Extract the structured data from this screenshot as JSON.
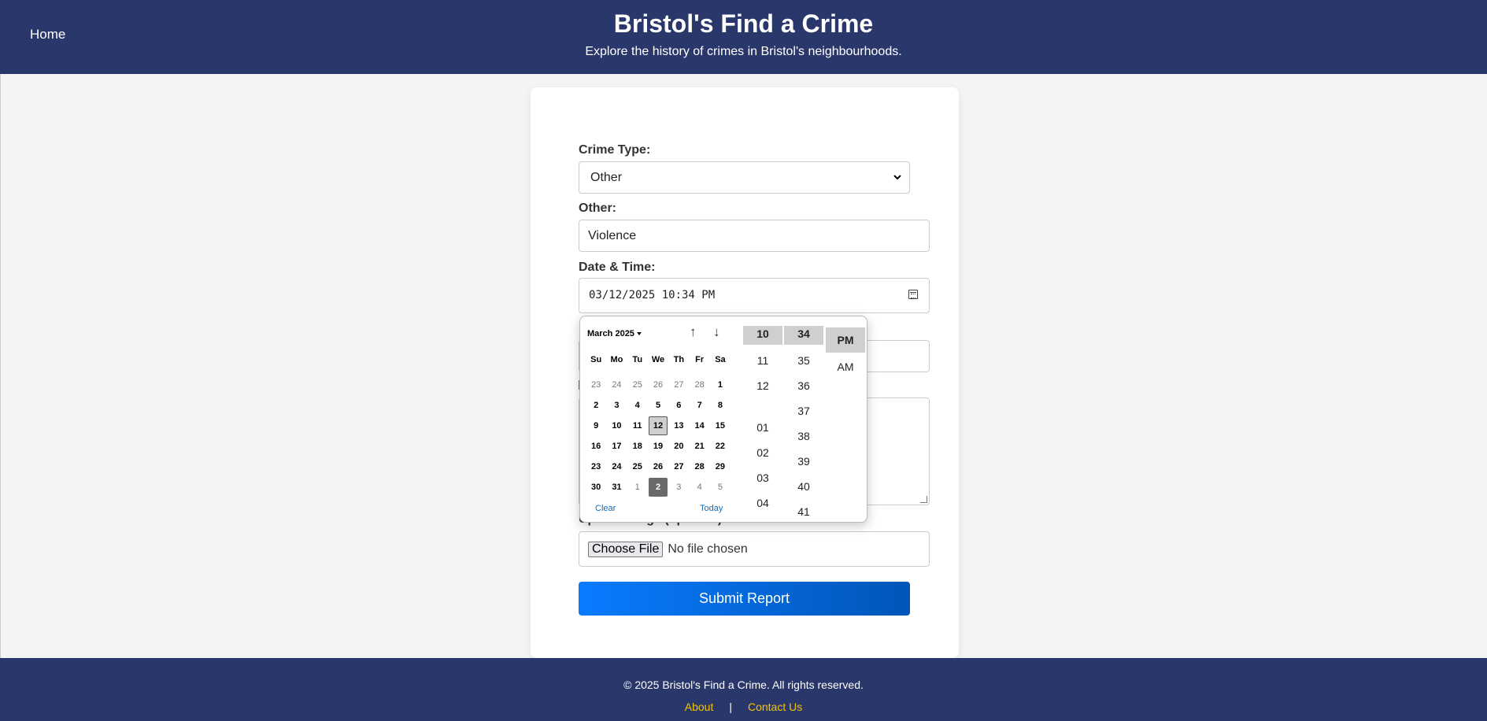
{
  "header": {
    "home_link": "Home",
    "title": "Bristol's Find a Crime",
    "subtitle": "Explore the history of crimes in Bristol's neighbourhoods."
  },
  "form": {
    "crime_type_label": "Crime Type:",
    "crime_type_value": "Other",
    "other_label": "Other:",
    "other_value": "Violence",
    "datetime_label": "Date & Time:",
    "datetime_value": "03/12/2025 10:34 PM",
    "upload_label": "Upload Image (optional):",
    "choose_file": "Choose File",
    "no_file": "No file chosen",
    "submit": "Submit Report"
  },
  "picker": {
    "month_label": "March 2025",
    "up_arrow": "↑",
    "down_arrow": "↓",
    "weekdays": [
      "Su",
      "Mo",
      "Tu",
      "We",
      "Th",
      "Fr",
      "Sa"
    ],
    "weeks": [
      [
        "23",
        "24",
        "25",
        "26",
        "27",
        "28",
        "1"
      ],
      [
        "2",
        "3",
        "4",
        "5",
        "6",
        "7",
        "8"
      ],
      [
        "9",
        "10",
        "11",
        "12",
        "13",
        "14",
        "15"
      ],
      [
        "16",
        "17",
        "18",
        "19",
        "20",
        "21",
        "22"
      ],
      [
        "23",
        "24",
        "25",
        "26",
        "27",
        "28",
        "29"
      ],
      [
        "30",
        "31",
        "1",
        "2",
        "3",
        "4",
        "5"
      ]
    ],
    "selected_day": "12",
    "today_day": "2",
    "clear_label": "Clear",
    "today_label": "Today",
    "hours": [
      "10",
      "11",
      "12",
      "01",
      "02",
      "03",
      "04"
    ],
    "minutes": [
      "34",
      "35",
      "36",
      "37",
      "38",
      "39",
      "40",
      "41"
    ],
    "ampm": [
      "PM",
      "AM"
    ]
  },
  "footer": {
    "copyright": "© 2025 Bristol's Find a Crime. All rights reserved.",
    "about": "About",
    "separator": "|",
    "contact": "Contact Us"
  },
  "colors": {
    "header_bg": "#2a376b",
    "submit_bg": "#0a7bff",
    "footer_link": "#f5c400"
  }
}
